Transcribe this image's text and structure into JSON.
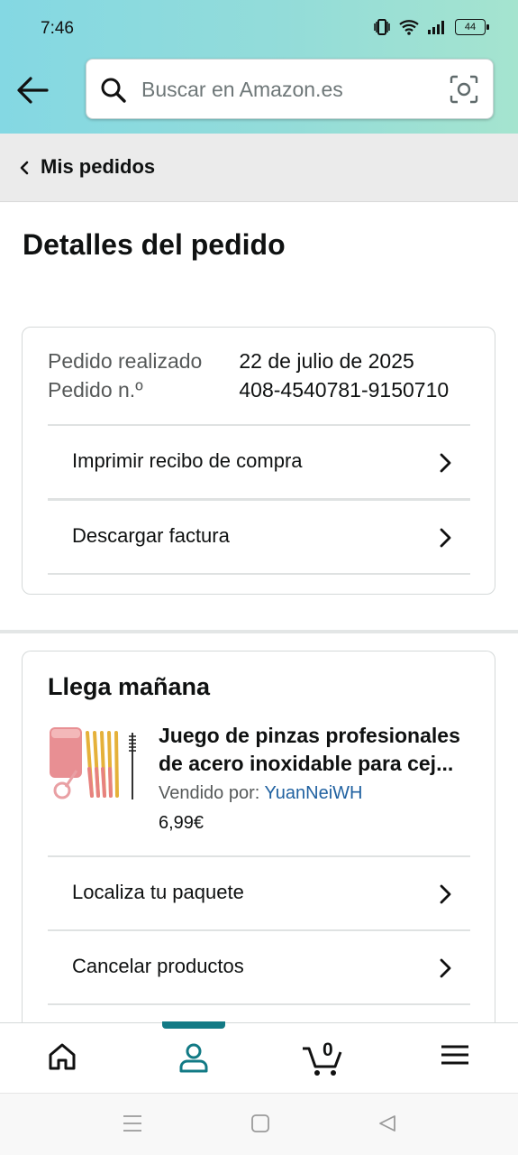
{
  "status_bar": {
    "time": "7:46",
    "battery": "44"
  },
  "search": {
    "placeholder": "Buscar en Amazon.es"
  },
  "breadcrumb": {
    "label": "Mis pedidos"
  },
  "page": {
    "title": "Detalles del pedido"
  },
  "order_info": {
    "date_label": "Pedido realizado",
    "date_value": "22 de julio de 2025",
    "number_label": "Pedido n.º",
    "number_value": "408-4540781-9150710"
  },
  "order_actions": [
    {
      "label": "Imprimir recibo de compra"
    },
    {
      "label": "Descargar factura"
    }
  ],
  "shipment": {
    "status": "Llega mañana",
    "product_title": "Juego de pinzas profesionales de acero inoxidable para cej...",
    "seller_label": "Vendido por: ",
    "seller_name": "YuanNeiWH",
    "price": "6,99€",
    "actions": [
      {
        "label": "Localiza tu paquete"
      },
      {
        "label": "Cancelar productos"
      }
    ]
  },
  "bottom_nav": {
    "items": [
      "home-icon",
      "account-icon",
      "cart-icon",
      "menu-icon"
    ],
    "active": "account-icon",
    "cart_count": "0",
    "accent_color": "#127a85"
  },
  "colors": {
    "link": "#2162a1",
    "text": "#0f1111",
    "muted": "#565959"
  }
}
